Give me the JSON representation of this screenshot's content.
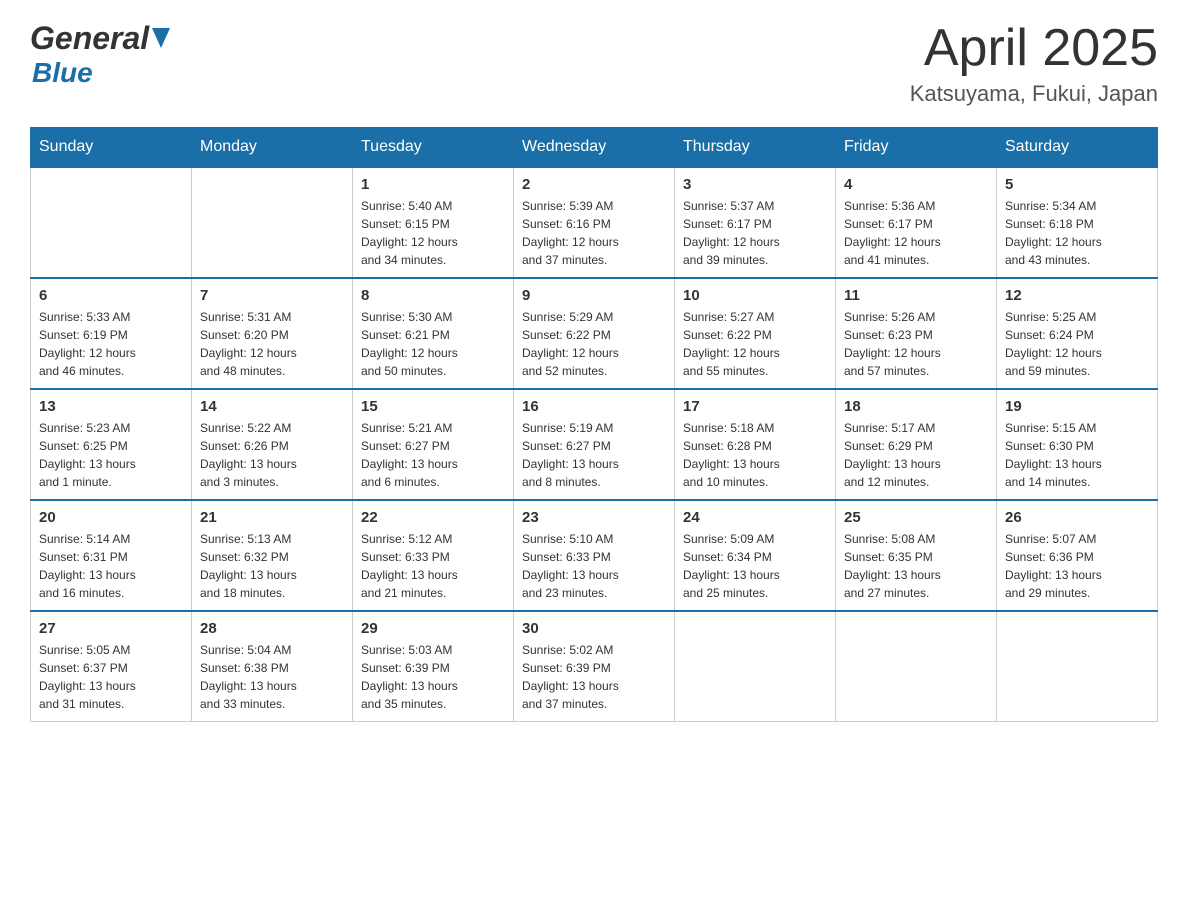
{
  "header": {
    "logo_general": "General",
    "logo_blue": "Blue",
    "title": "April 2025",
    "subtitle": "Katsuyama, Fukui, Japan"
  },
  "days_of_week": [
    "Sunday",
    "Monday",
    "Tuesday",
    "Wednesday",
    "Thursday",
    "Friday",
    "Saturday"
  ],
  "weeks": [
    [
      {
        "day": "",
        "info": ""
      },
      {
        "day": "",
        "info": ""
      },
      {
        "day": "1",
        "info": "Sunrise: 5:40 AM\nSunset: 6:15 PM\nDaylight: 12 hours\nand 34 minutes."
      },
      {
        "day": "2",
        "info": "Sunrise: 5:39 AM\nSunset: 6:16 PM\nDaylight: 12 hours\nand 37 minutes."
      },
      {
        "day": "3",
        "info": "Sunrise: 5:37 AM\nSunset: 6:17 PM\nDaylight: 12 hours\nand 39 minutes."
      },
      {
        "day": "4",
        "info": "Sunrise: 5:36 AM\nSunset: 6:17 PM\nDaylight: 12 hours\nand 41 minutes."
      },
      {
        "day": "5",
        "info": "Sunrise: 5:34 AM\nSunset: 6:18 PM\nDaylight: 12 hours\nand 43 minutes."
      }
    ],
    [
      {
        "day": "6",
        "info": "Sunrise: 5:33 AM\nSunset: 6:19 PM\nDaylight: 12 hours\nand 46 minutes."
      },
      {
        "day": "7",
        "info": "Sunrise: 5:31 AM\nSunset: 6:20 PM\nDaylight: 12 hours\nand 48 minutes."
      },
      {
        "day": "8",
        "info": "Sunrise: 5:30 AM\nSunset: 6:21 PM\nDaylight: 12 hours\nand 50 minutes."
      },
      {
        "day": "9",
        "info": "Sunrise: 5:29 AM\nSunset: 6:22 PM\nDaylight: 12 hours\nand 52 minutes."
      },
      {
        "day": "10",
        "info": "Sunrise: 5:27 AM\nSunset: 6:22 PM\nDaylight: 12 hours\nand 55 minutes."
      },
      {
        "day": "11",
        "info": "Sunrise: 5:26 AM\nSunset: 6:23 PM\nDaylight: 12 hours\nand 57 minutes."
      },
      {
        "day": "12",
        "info": "Sunrise: 5:25 AM\nSunset: 6:24 PM\nDaylight: 12 hours\nand 59 minutes."
      }
    ],
    [
      {
        "day": "13",
        "info": "Sunrise: 5:23 AM\nSunset: 6:25 PM\nDaylight: 13 hours\nand 1 minute."
      },
      {
        "day": "14",
        "info": "Sunrise: 5:22 AM\nSunset: 6:26 PM\nDaylight: 13 hours\nand 3 minutes."
      },
      {
        "day": "15",
        "info": "Sunrise: 5:21 AM\nSunset: 6:27 PM\nDaylight: 13 hours\nand 6 minutes."
      },
      {
        "day": "16",
        "info": "Sunrise: 5:19 AM\nSunset: 6:27 PM\nDaylight: 13 hours\nand 8 minutes."
      },
      {
        "day": "17",
        "info": "Sunrise: 5:18 AM\nSunset: 6:28 PM\nDaylight: 13 hours\nand 10 minutes."
      },
      {
        "day": "18",
        "info": "Sunrise: 5:17 AM\nSunset: 6:29 PM\nDaylight: 13 hours\nand 12 minutes."
      },
      {
        "day": "19",
        "info": "Sunrise: 5:15 AM\nSunset: 6:30 PM\nDaylight: 13 hours\nand 14 minutes."
      }
    ],
    [
      {
        "day": "20",
        "info": "Sunrise: 5:14 AM\nSunset: 6:31 PM\nDaylight: 13 hours\nand 16 minutes."
      },
      {
        "day": "21",
        "info": "Sunrise: 5:13 AM\nSunset: 6:32 PM\nDaylight: 13 hours\nand 18 minutes."
      },
      {
        "day": "22",
        "info": "Sunrise: 5:12 AM\nSunset: 6:33 PM\nDaylight: 13 hours\nand 21 minutes."
      },
      {
        "day": "23",
        "info": "Sunrise: 5:10 AM\nSunset: 6:33 PM\nDaylight: 13 hours\nand 23 minutes."
      },
      {
        "day": "24",
        "info": "Sunrise: 5:09 AM\nSunset: 6:34 PM\nDaylight: 13 hours\nand 25 minutes."
      },
      {
        "day": "25",
        "info": "Sunrise: 5:08 AM\nSunset: 6:35 PM\nDaylight: 13 hours\nand 27 minutes."
      },
      {
        "day": "26",
        "info": "Sunrise: 5:07 AM\nSunset: 6:36 PM\nDaylight: 13 hours\nand 29 minutes."
      }
    ],
    [
      {
        "day": "27",
        "info": "Sunrise: 5:05 AM\nSunset: 6:37 PM\nDaylight: 13 hours\nand 31 minutes."
      },
      {
        "day": "28",
        "info": "Sunrise: 5:04 AM\nSunset: 6:38 PM\nDaylight: 13 hours\nand 33 minutes."
      },
      {
        "day": "29",
        "info": "Sunrise: 5:03 AM\nSunset: 6:39 PM\nDaylight: 13 hours\nand 35 minutes."
      },
      {
        "day": "30",
        "info": "Sunrise: 5:02 AM\nSunset: 6:39 PM\nDaylight: 13 hours\nand 37 minutes."
      },
      {
        "day": "",
        "info": ""
      },
      {
        "day": "",
        "info": ""
      },
      {
        "day": "",
        "info": ""
      }
    ]
  ]
}
